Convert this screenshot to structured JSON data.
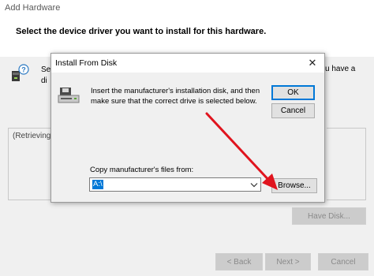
{
  "wizard": {
    "title": "Add Hardware",
    "heading": "Select the device driver you want to install for this hardware.",
    "body_left_fragment": "Se\ndi",
    "body_right_fragment": "u have a",
    "list_status": "(Retrieving",
    "have_disk_label": "Have Disk...",
    "back_label": "< Back",
    "next_label": "Next >",
    "cancel_label": "Cancel"
  },
  "dialog": {
    "title": "Install From Disk",
    "close_glyph": "✕",
    "message": "Insert the manufacturer's installation disk, and then make sure that the correct drive is selected below.",
    "ok_label": "OK",
    "cancel_label": "Cancel",
    "copy_label": "Copy manufacturer's files from:",
    "path_value": "A:\\",
    "browse_label": "Browse..."
  },
  "annotation": {
    "arrow_color": "#e0141e"
  },
  "icons": {
    "hardware": "hardware-help-icon",
    "disk": "floppy-drive-icon",
    "combo": "chevron-down-icon"
  }
}
